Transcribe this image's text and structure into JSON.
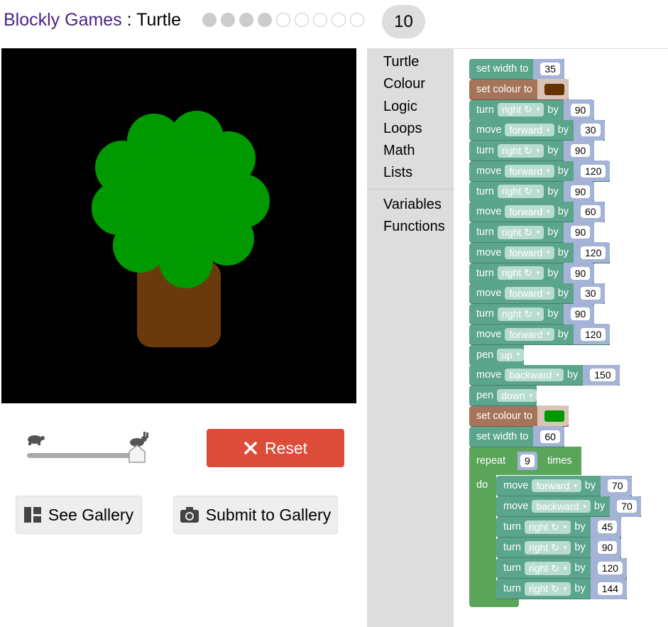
{
  "header": {
    "brand": "Blockly Games",
    "separator": " : ",
    "app": "Turtle",
    "levels": [
      true,
      true,
      true,
      true,
      false,
      false,
      false,
      false,
      false
    ],
    "current_level": "10"
  },
  "controls": {
    "speed_slider": 1.0,
    "reset_label": "Reset",
    "gallery_label": "See Gallery",
    "submit_label": "Submit to Gallery"
  },
  "toolbox": {
    "categories": [
      "Turtle",
      "Colour",
      "Logic",
      "Loops",
      "Math",
      "Lists"
    ],
    "categories2": [
      "Variables",
      "Functions"
    ]
  },
  "colors": {
    "background": "#000000",
    "trunk": "#6b3a0c",
    "leaves": "#009900",
    "brown_swatch": "#663300",
    "green_swatch": "#009900"
  },
  "blocks": [
    {
      "kind": "width",
      "label": "set width to",
      "value": "35"
    },
    {
      "kind": "colour",
      "label": "set colour to",
      "color": "#663300"
    },
    {
      "kind": "turn",
      "label": "turn",
      "dd": "right ↻",
      "by": "by",
      "value": "90"
    },
    {
      "kind": "move",
      "label": "move",
      "dd": "forward",
      "by": "by",
      "value": "30"
    },
    {
      "kind": "turn",
      "label": "turn",
      "dd": "right ↻",
      "by": "by",
      "value": "90"
    },
    {
      "kind": "move",
      "label": "move",
      "dd": "forward",
      "by": "by",
      "value": "120"
    },
    {
      "kind": "turn",
      "label": "turn",
      "dd": "right ↻",
      "by": "by",
      "value": "90"
    },
    {
      "kind": "move",
      "label": "move",
      "dd": "forward",
      "by": "by",
      "value": "60"
    },
    {
      "kind": "turn",
      "label": "turn",
      "dd": "right ↻",
      "by": "by",
      "value": "90"
    },
    {
      "kind": "move",
      "label": "move",
      "dd": "forward",
      "by": "by",
      "value": "120"
    },
    {
      "kind": "turn",
      "label": "turn",
      "dd": "right ↻",
      "by": "by",
      "value": "90"
    },
    {
      "kind": "move",
      "label": "move",
      "dd": "forward",
      "by": "by",
      "value": "30"
    },
    {
      "kind": "turn",
      "label": "turn",
      "dd": "right ↻",
      "by": "by",
      "value": "90"
    },
    {
      "kind": "move",
      "label": "move",
      "dd": "forward",
      "by": "by",
      "value": "120"
    },
    {
      "kind": "pen",
      "label": "pen",
      "dd": "up"
    },
    {
      "kind": "move",
      "label": "move",
      "dd": "backward",
      "by": "by",
      "value": "150"
    },
    {
      "kind": "pen",
      "label": "pen",
      "dd": "down"
    },
    {
      "kind": "colour",
      "label": "set colour to",
      "color": "#009900"
    },
    {
      "kind": "width",
      "label": "set width to",
      "value": "60"
    }
  ],
  "repeat": {
    "label": "repeat",
    "times": "9",
    "times_label": "times",
    "do_label": "do",
    "body": [
      {
        "kind": "move",
        "label": "move",
        "dd": "forward",
        "by": "by",
        "value": "70"
      },
      {
        "kind": "move",
        "label": "move",
        "dd": "backward",
        "by": "by",
        "value": "70"
      },
      {
        "kind": "turn",
        "label": "turn",
        "dd": "right ↻",
        "by": "by",
        "value": "45"
      },
      {
        "kind": "turn",
        "label": "turn",
        "dd": "right ↻",
        "by": "by",
        "value": "90"
      },
      {
        "kind": "turn",
        "label": "turn",
        "dd": "right ↻",
        "by": "by",
        "value": "120"
      },
      {
        "kind": "turn",
        "label": "turn",
        "dd": "right ↻",
        "by": "by",
        "value": "144"
      }
    ]
  }
}
